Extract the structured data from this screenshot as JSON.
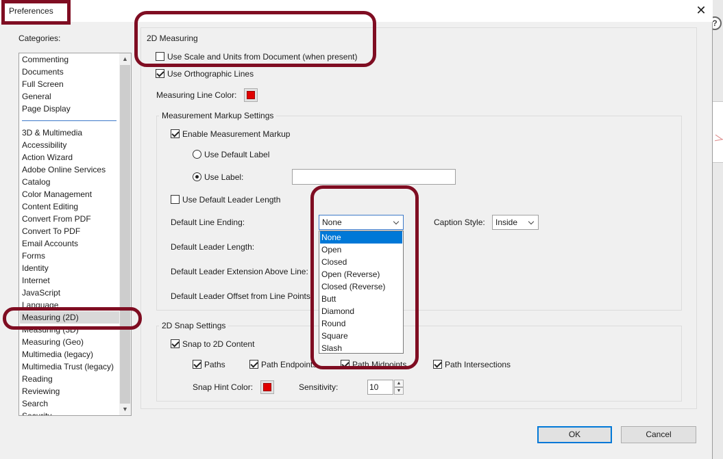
{
  "window": {
    "title": "Preferences",
    "close_glyph": "✕"
  },
  "background_app": {
    "help_glyph": "?"
  },
  "categories": {
    "label": "Categories:",
    "group1": [
      "Commenting",
      "Documents",
      "Full Screen",
      "General",
      "Page Display"
    ],
    "group2": [
      "3D & Multimedia",
      "Accessibility",
      "Action Wizard",
      "Adobe Online Services",
      "Catalog",
      "Color Management",
      "Content Editing",
      "Convert From PDF",
      "Convert To PDF",
      "Email Accounts",
      "Forms",
      "Identity",
      "Internet",
      "JavaScript",
      "Language",
      "Measuring (2D)",
      "Measuring (3D)",
      "Measuring (Geo)",
      "Multimedia (legacy)",
      "Multimedia Trust (legacy)",
      "Reading",
      "Reviewing",
      "Search",
      "Security"
    ],
    "selected": "Measuring (2D)"
  },
  "measuring": {
    "section_title": "2D Measuring",
    "use_scale_units": {
      "label": "Use Scale and Units from Document (when present)",
      "checked": false
    },
    "use_ortho_lines": {
      "label": "Use Orthographic Lines",
      "checked": true
    },
    "line_color_label": "Measuring Line Color:",
    "line_color": "#e00000"
  },
  "markup": {
    "title": "Measurement Markup Settings",
    "enable": {
      "label": "Enable Measurement Markup",
      "checked": true
    },
    "default_label": {
      "label": "Use Default Label",
      "checked": false
    },
    "use_label": {
      "label": "Use Label:",
      "checked": true,
      "value": ""
    },
    "default_leader_length": {
      "label": "Use Default Leader Length",
      "checked": false
    },
    "line_ending_label": "Default Line Ending:",
    "line_ending_value": "None",
    "line_ending_options": [
      "None",
      "Open",
      "Closed",
      "Open (Reverse)",
      "Closed (Reverse)",
      "Butt",
      "Diamond",
      "Round",
      "Square",
      "Slash"
    ],
    "caption_style_label": "Caption Style:",
    "caption_style_value": "Inside",
    "leader_length_label": "Default Leader Length:",
    "leader_extension_label": "Default Leader Extension Above Line:",
    "leader_offset_label": "Default Leader Offset from Line Points:"
  },
  "snap": {
    "title": "2D Snap Settings",
    "snap_content": {
      "label": "Snap to 2D Content",
      "checked": true
    },
    "paths": {
      "label": "Paths",
      "checked": true
    },
    "path_endpoints": {
      "label": "Path Endpoints",
      "checked": true
    },
    "path_midpoints": {
      "label": "Path Midpoints",
      "checked": true
    },
    "path_intersections": {
      "label": "Path Intersections",
      "checked": true
    },
    "hint_color_label": "Snap Hint Color:",
    "hint_color": "#e00000",
    "sensitivity_label": "Sensitivity:",
    "sensitivity_value": "10"
  },
  "buttons": {
    "ok": "OK",
    "cancel": "Cancel"
  },
  "annotation_color": "#7f0d22"
}
